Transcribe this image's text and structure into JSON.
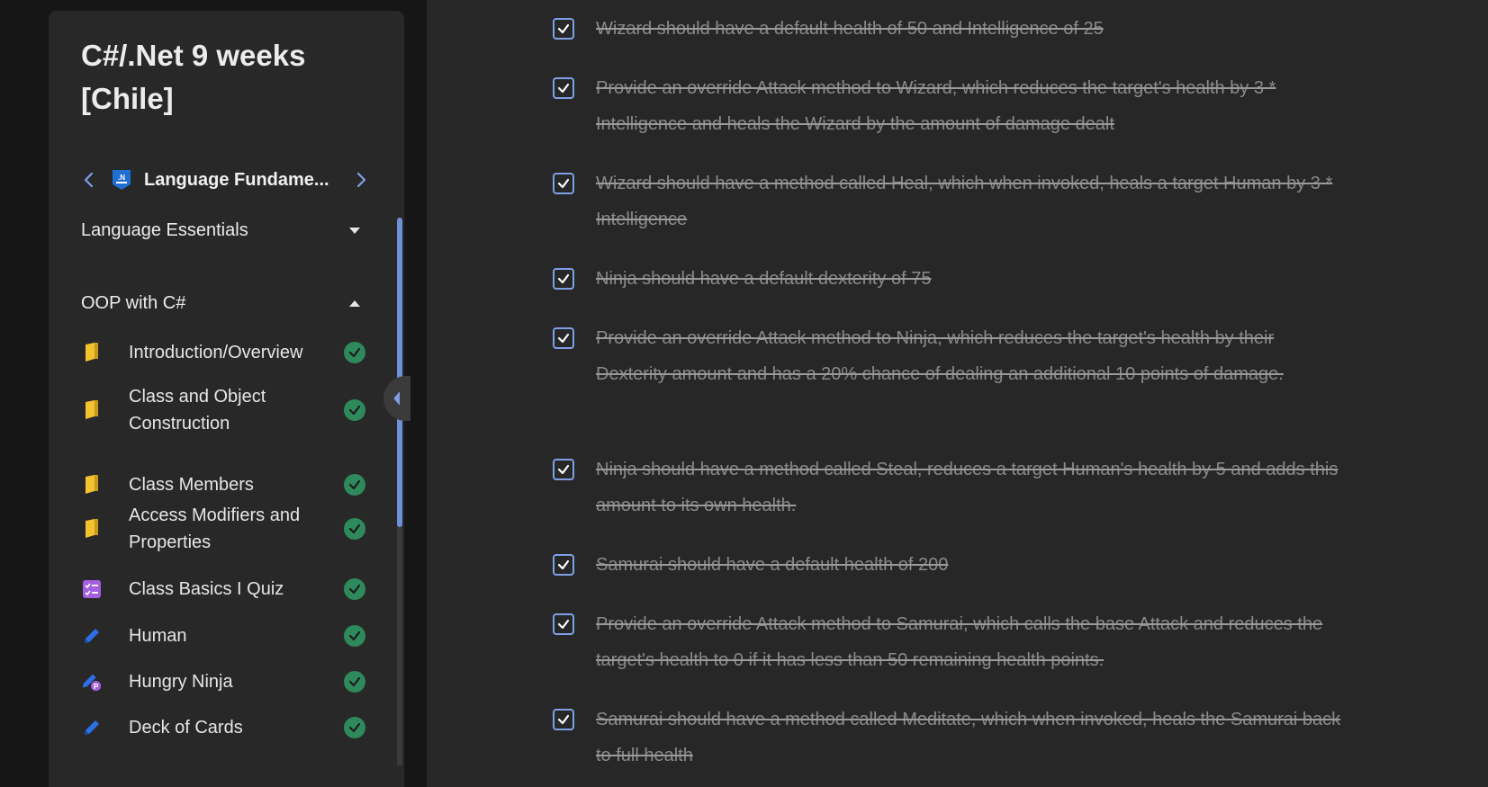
{
  "sidebar": {
    "course_title": "C#/.Net 9 weeks [Chile]",
    "module_name": "Language Fundame...",
    "module_logo": "dotnet-logo",
    "sections": [
      {
        "label": "Language Essentials",
        "state": "collapsed"
      },
      {
        "label": "OOP with C#",
        "state": "expanded"
      }
    ],
    "lessons": [
      {
        "label": "Introduction/Overview",
        "icon": "book-icon",
        "completed": true
      },
      {
        "label": "Class and Object Construction",
        "icon": "book-icon",
        "completed": true
      },
      {
        "label": "Class Members",
        "icon": "book-icon",
        "completed": true
      },
      {
        "label": "Access Modifiers and Properties",
        "icon": "book-icon",
        "completed": true
      },
      {
        "label": "Class Basics I Quiz",
        "icon": "quiz-icon",
        "completed": true
      },
      {
        "label": "Human",
        "icon": "pencil-icon",
        "completed": true
      },
      {
        "label": "Hungry Ninja",
        "icon": "pencil-badge-icon",
        "completed": true
      },
      {
        "label": "Deck of Cards",
        "icon": "pencil-icon",
        "completed": true
      }
    ]
  },
  "tasks": [
    {
      "text": "Wizard should have a default health of 50 and Intelligence of 25",
      "checked": true
    },
    {
      "text": "Provide an override Attack method to Wizard, which reduces the target's health by 3 * Intelligence and heals the Wizard by the amount of damage dealt",
      "checked": true
    },
    {
      "text": "Wizard should have a method called Heal, which when invoked, heals a target Human by 3 * Intelligence",
      "checked": true
    },
    {
      "text": "Ninja should have a default dexterity of 75",
      "checked": true
    },
    {
      "text": "Provide an override Attack method to Ninja, which reduces the target's health by their Dexterity amount and has a 20% chance of dealing an additional 10 points of damage.",
      "checked": true
    },
    {
      "text": "Ninja should have a method called Steal, reduces a target Human's health by 5 and adds this amount to its own health.",
      "checked": true
    },
    {
      "text": "Samurai should have a default health of 200",
      "checked": true
    },
    {
      "text": "Provide an override Attack method to Samurai, which calls the base Attack and reduces the target's health to 0 if it has less than 50 remaining health points.",
      "checked": true
    },
    {
      "text": "Samurai should have a method called Meditate, which when invoked, heals the Samurai back to full health",
      "checked": true
    }
  ],
  "colors": {
    "accent": "#7fa0e8",
    "complete": "#2e8a5a",
    "book": "#f2c230",
    "quiz": "#a55ee0",
    "pencil": "#2e6fe8"
  }
}
